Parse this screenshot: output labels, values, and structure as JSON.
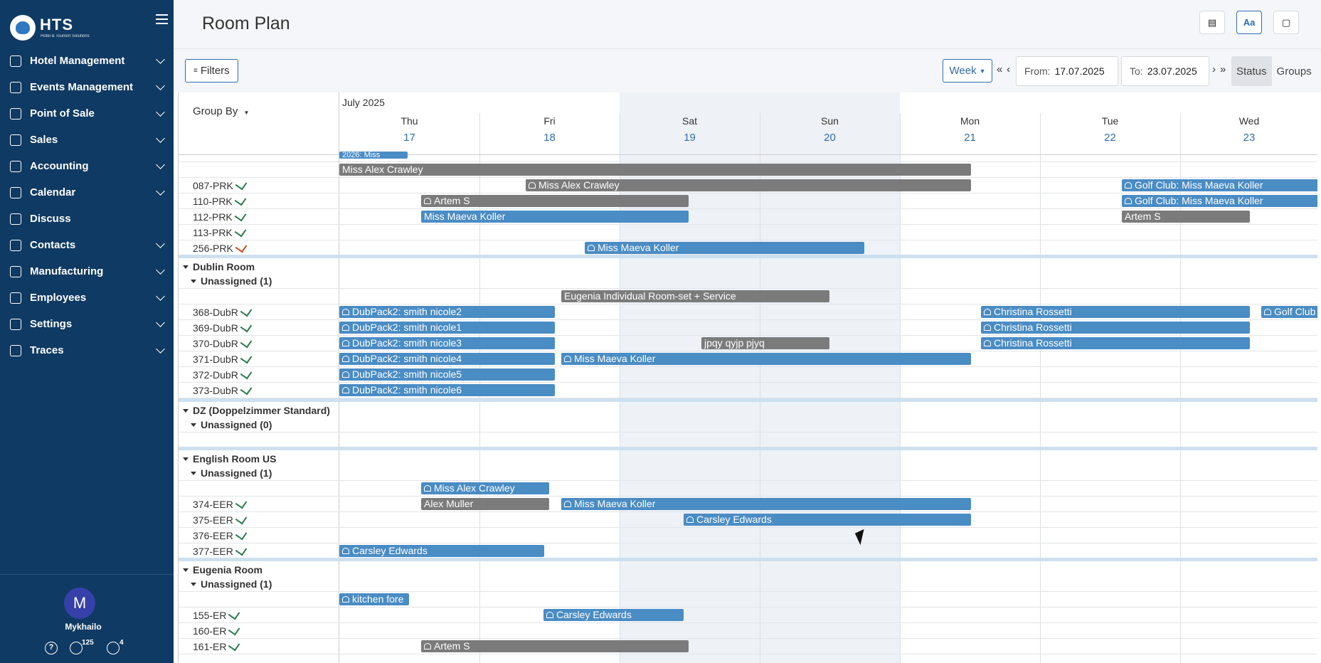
{
  "sidebar": {
    "logo": "HTS",
    "logo_sub": "Hotel & Tourism Solutions",
    "items": [
      {
        "label": "Hotel Management",
        "icon": "bell-icon"
      },
      {
        "label": "Events Management",
        "icon": "calendar-plus-icon"
      },
      {
        "label": "Point of Sale",
        "icon": "store-icon"
      },
      {
        "label": "Sales",
        "icon": "briefcase-icon"
      },
      {
        "label": "Accounting",
        "icon": "money-bag-icon"
      },
      {
        "label": "Calendar",
        "icon": "calendar-icon"
      },
      {
        "label": "Discuss",
        "icon": "chat-icon"
      },
      {
        "label": "Contacts",
        "icon": "contacts-icon"
      },
      {
        "label": "Manufacturing",
        "icon": "factory-icon"
      },
      {
        "label": "Employees",
        "icon": "people-icon"
      },
      {
        "label": "Settings",
        "icon": "gear-icon"
      },
      {
        "label": "Traces",
        "icon": "checkbox-icon"
      }
    ],
    "user": {
      "initial": "M",
      "name": "Mykhailo",
      "messages": "125",
      "notifications": "4"
    }
  },
  "topbar": {
    "title": "Room Plan",
    "font_btn": "Aa"
  },
  "controls": {
    "filters": "Filters",
    "period": "Week",
    "from_label": "From:",
    "from_value": "17.07.2025",
    "to_label": "To:",
    "to_value": "23.07.2025",
    "view_status": "Status",
    "view_groups": "Groups"
  },
  "grid": {
    "month": "July 2025",
    "group_by": "Group By",
    "days": [
      {
        "name": "Thu",
        "num": "17"
      },
      {
        "name": "Fri",
        "num": "18"
      },
      {
        "name": "Sat",
        "num": "19"
      },
      {
        "name": "Sun",
        "num": "20"
      },
      {
        "name": "Mon",
        "num": "21"
      },
      {
        "name": "Tue",
        "num": "22"
      },
      {
        "name": "Wed",
        "num": "23"
      }
    ],
    "rooms": {
      "r087": "087-PRK",
      "r110": "110-PRK",
      "r112": "112-PRK",
      "r113": "113-PRK",
      "r256": "256-PRK",
      "r368": "368-DubR",
      "r369": "369-DubR",
      "r370": "370-DubR",
      "r371": "371-DubR",
      "r372": "372-DubR",
      "r373": "373-DubR",
      "r374": "374-EER",
      "r375": "375-EER",
      "r376": "376-EER",
      "r377": "377-EER",
      "r155": "155-ER",
      "r160": "160-ER",
      "r161": "161-ER"
    },
    "groups": {
      "dublin": "Dublin Room",
      "dublin_un": "Unassigned (1)",
      "dz": "DZ (Doppelzimmer Standard)",
      "dz_un": "Unassigned (0)",
      "english": "English Room US",
      "english_un": "Unassigned (1)",
      "eugenia": "Eugenia Room",
      "eugenia_un": "Unassigned (1)"
    },
    "bookings": {
      "b0": "2026: Miss",
      "b1": "Miss Alex Crawley",
      "b2": "Miss Alex Crawley",
      "b3": "Golf Club: Miss Maeva Koller",
      "b4": "Artem S",
      "b5": "Golf Club: Miss Maeva Koller",
      "b6": "Miss Maeva Koller",
      "b7": "Artem S",
      "b8": "Miss Maeva Koller",
      "b9": "Eugenia Individual Room-set + Service",
      "b10": "DubPack2: smith nicole2",
      "b11": "Christina Rossetti",
      "b12": "Golf Club",
      "b13": "DubPack2: smith nicole1",
      "b14": "Christina Rossetti",
      "b15": "DubPack2: smith nicole3",
      "b16": "jpqy qyjp pjyq",
      "b17": "Christina Rossetti",
      "b18": "DubPack2: smith nicole4",
      "b19": "Miss Maeva Koller",
      "b20": "DubPack2: smith nicole5",
      "b21": "DubPack2: smith nicole6",
      "b22": "Miss Alex Crawley",
      "b23": "Alex Muller",
      "b24": "Miss Maeva Koller",
      "b25": "Carsley Edwards",
      "b26": "Carsley Edwards",
      "b27": "kitchen fore",
      "b28": "Carsley Edwards",
      "b29": "Artem S"
    }
  }
}
